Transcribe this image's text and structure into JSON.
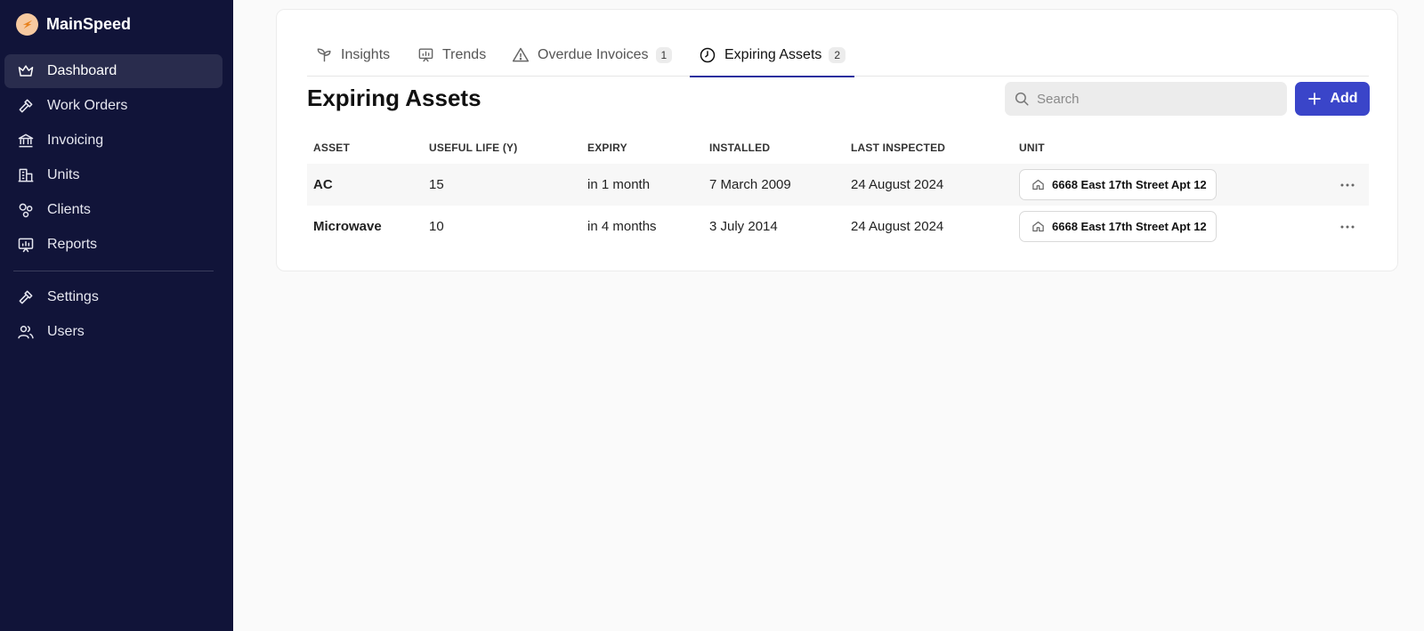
{
  "brand": {
    "name": "MainSpeed",
    "logo_icon": "bolt-logo-icon"
  },
  "sidebar": {
    "items": [
      {
        "label": "Dashboard",
        "icon": "crown-icon",
        "active": true
      },
      {
        "label": "Work Orders",
        "icon": "hammer-icon"
      },
      {
        "label": "Invoicing",
        "icon": "bank-icon"
      },
      {
        "label": "Units",
        "icon": "building-icon"
      },
      {
        "label": "Clients",
        "icon": "clients-icon"
      },
      {
        "label": "Reports",
        "icon": "presentation-chart-icon"
      }
    ],
    "secondary_items": [
      {
        "label": "Settings",
        "icon": "hammer-icon"
      },
      {
        "label": "Users",
        "icon": "users-icon"
      }
    ]
  },
  "tabs": [
    {
      "label": "Insights",
      "icon": "sprout-icon"
    },
    {
      "label": "Trends",
      "icon": "presentation-chart-icon"
    },
    {
      "label": "Overdue Invoices",
      "icon": "warning-triangle-icon",
      "badge": "1"
    },
    {
      "label": "Expiring Assets",
      "icon": "clock-icon",
      "badge": "2",
      "active": true
    }
  ],
  "page": {
    "title": "Expiring Assets",
    "search_placeholder": "Search",
    "add_label": "Add"
  },
  "table": {
    "columns": [
      "ASSET",
      "USEFUL LIFE (Y)",
      "EXPIRY",
      "INSTALLED",
      "LAST INSPECTED",
      "UNIT"
    ],
    "rows": [
      {
        "asset": "AC",
        "useful_life": "15",
        "expiry": "in 1 month",
        "installed": "7 March 2009",
        "last_inspected": "24 August 2024",
        "unit": "6668 East 17th Street Apt 12"
      },
      {
        "asset": "Microwave",
        "useful_life": "10",
        "expiry": "in 4 months",
        "installed": "3 July 2014",
        "last_inspected": "24 August 2024",
        "unit": "6668 East 17th Street Apt 12"
      }
    ]
  },
  "colors": {
    "sidebar_bg": "#111439",
    "accent": "#3a45c9",
    "tab_underline": "#2b2f9e"
  }
}
